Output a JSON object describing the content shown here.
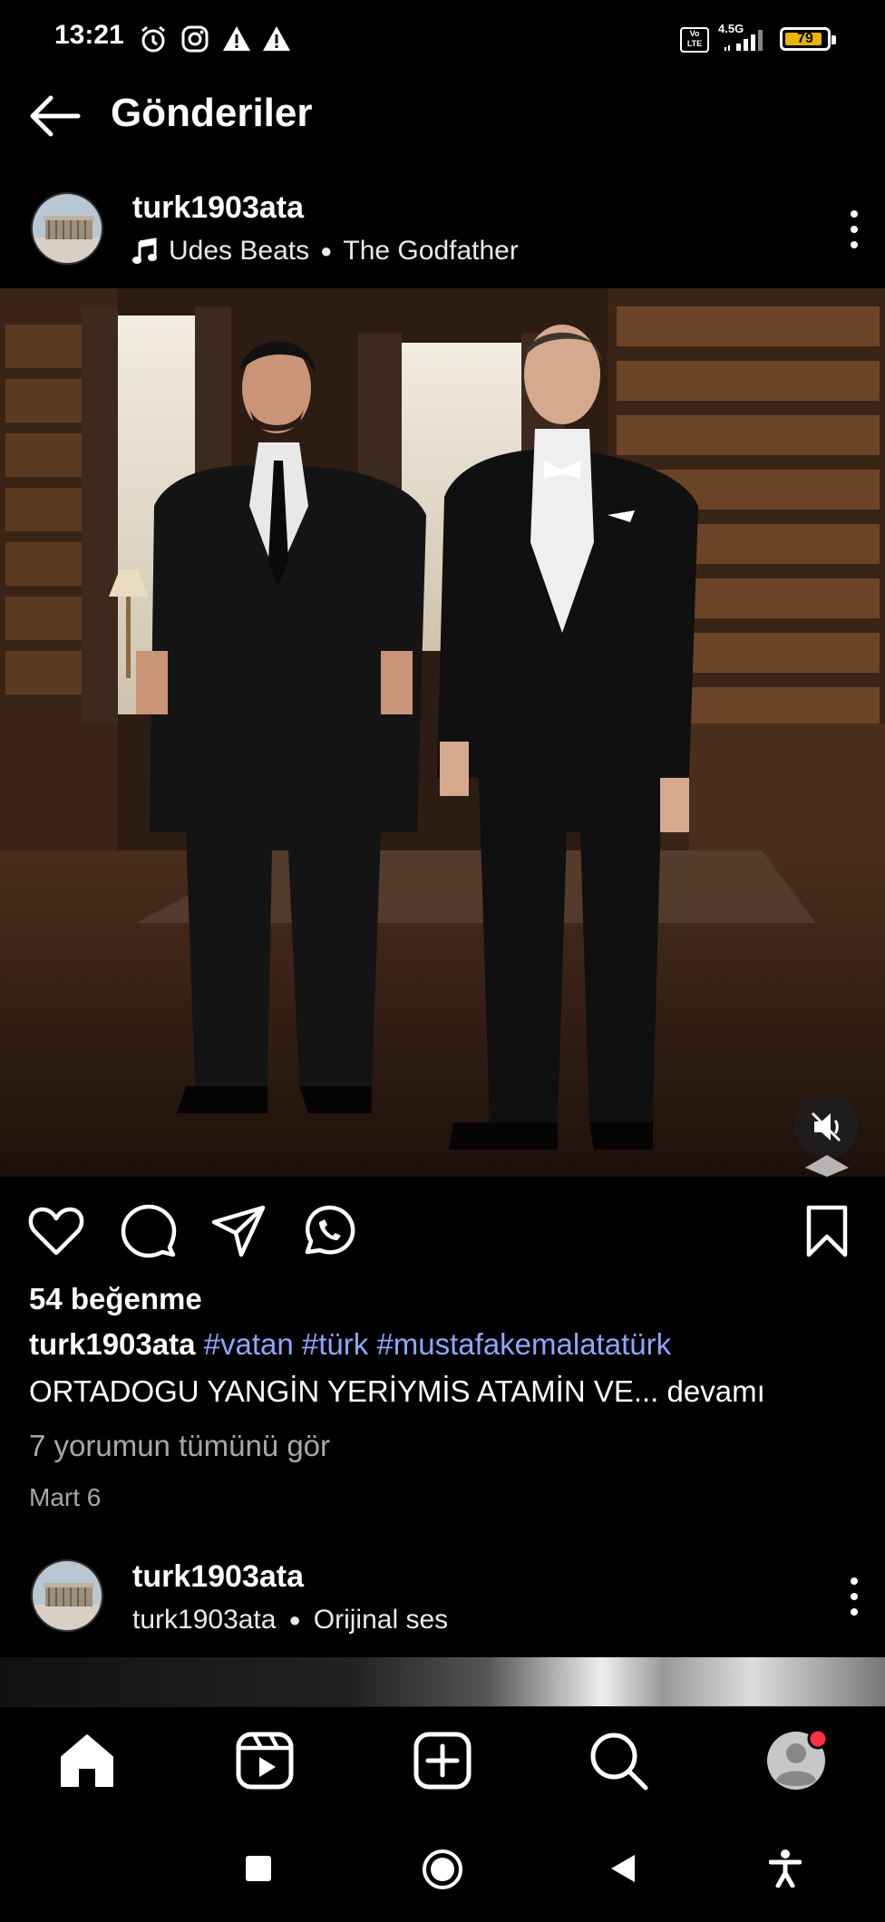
{
  "status_bar": {
    "time": "13:21",
    "network": "4.5G",
    "lte": "Vo LTE",
    "battery": "79",
    "icons": [
      "alarm-icon",
      "instagram-icon",
      "warning-icon",
      "warning-icon"
    ]
  },
  "header": {
    "title": "Gönderiler"
  },
  "post": {
    "username": "turk1903ata",
    "music": "Udes Beats",
    "song": "The Godfather",
    "likes": "54 beğenme",
    "caption_user": "turk1903ata",
    "hashtags": [
      "#vatan",
      "#türk",
      "#mustafakemalatatürk"
    ],
    "caption_text": "ORTADOGU YANGİN YERİYMİS ATAMİN VE...",
    "more": "devamı",
    "comments_link": "7 yorumun tümünü gör",
    "date": "Mart 6"
  },
  "next_post": {
    "username": "turk1903ata",
    "audio_user": "turk1903ata",
    "audio": "Orijinal ses"
  },
  "bottom_nav": [
    "home-icon",
    "reels-icon",
    "create-icon",
    "search-icon",
    "profile-avatar"
  ],
  "colors": {
    "hashtag": "#8fa6ff",
    "notification": "#ff3040",
    "battery": "#e8b500"
  }
}
